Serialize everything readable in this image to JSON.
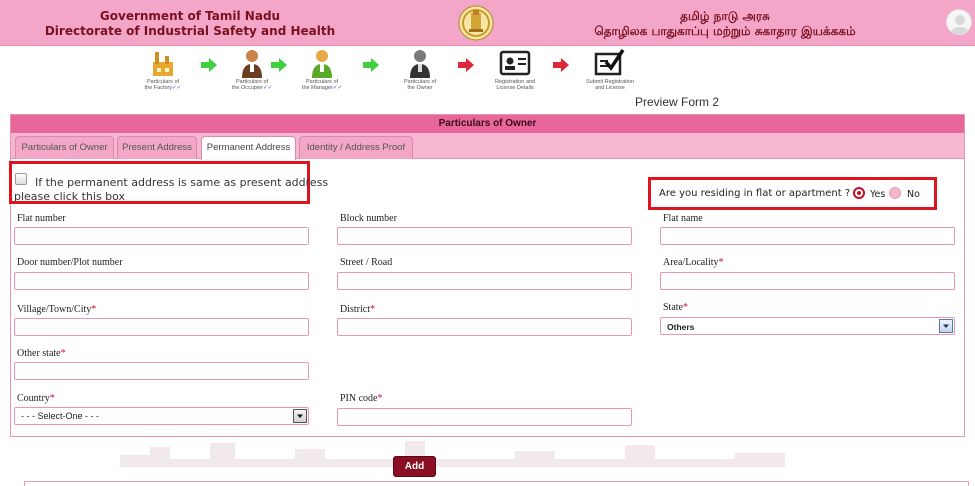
{
  "header": {
    "left_line1": "Government of Tamil Nadu",
    "left_line2": "Directorate of Industrial Safety and Health",
    "right_line1": "தமிழ் நாடு அரசு",
    "right_line2": "தொழிலக பாதுகாப்பு மற்றும் சுகாதார இயக்ககம்",
    "emblem_icon": "tamil-nadu-emblem",
    "avatar_icon": "user-avatar-icon"
  },
  "steps": [
    {
      "label1": "Particulars of",
      "label2": "the Factory",
      "done": "✓✓",
      "icon": "factory-icon"
    },
    {
      "label1": "Particulars of",
      "label2": "the Occupier",
      "done": "✓✓",
      "icon": "occupier-icon"
    },
    {
      "label1": "Particulars of",
      "label2": "the Manager",
      "done": "✓✓",
      "icon": "manager-icon"
    },
    {
      "label1": "Particulars of",
      "label2": "the Owner",
      "done": "",
      "icon": "owner-icon"
    },
    {
      "label1": "Registration and",
      "label2": "License Details",
      "done": "",
      "icon": "registration-card-icon"
    },
    {
      "label1": "Submit Registration",
      "label2": "and License",
      "done": "",
      "icon": "submit-check-icon"
    }
  ],
  "preview_label": "Preview Form 2",
  "panel": {
    "title": "Particulars of Owner",
    "tabs": [
      "Particulars of Owner",
      "Present Address",
      "Permanent Address",
      "Identity / Address Proof"
    ],
    "active_tab": "Permanent Address"
  },
  "same_address": {
    "line1": "If the permanent address is same as present address",
    "line2": "please click this box",
    "checked": false
  },
  "residence": {
    "question": "Are you residing in flat or apartment ?",
    "yes": "Yes",
    "no": "No",
    "selected": "Yes"
  },
  "fields": {
    "flat_number": {
      "label": "Flat number",
      "required": "",
      "value": ""
    },
    "block_number": {
      "label": "Block number",
      "required": "",
      "value": ""
    },
    "flat_name": {
      "label": "Flat name",
      "required": "",
      "value": ""
    },
    "door_number": {
      "label": "Door number/Plot number",
      "required": "",
      "value": ""
    },
    "street": {
      "label": "Street / Road",
      "required": "",
      "value": ""
    },
    "area": {
      "label": "Area/Locality",
      "required": "*",
      "value": ""
    },
    "village": {
      "label": "Village/Town/City",
      "required": "*",
      "value": ""
    },
    "district": {
      "label": "District",
      "required": "*",
      "value": ""
    },
    "state": {
      "label": "State",
      "required": "*",
      "value": "Others"
    },
    "other_state": {
      "label": "Other state",
      "required": "*",
      "value": ""
    },
    "country": {
      "label": "Country",
      "required": "*",
      "value": "- - - Select-One - - -"
    },
    "pin_code": {
      "label": "PIN code",
      "required": "*",
      "value": ""
    }
  },
  "add_button": "Add",
  "colors": {
    "header_bg": "#f3a6c8",
    "header_text": "#7a1020",
    "panel_title_bg": "#e8679a",
    "tabbar_bg": "#f6b6cf",
    "highlight_red": "#e0141e",
    "add_button_bg": "#8a0f22",
    "arrow_green": "#3fcf3f",
    "arrow_red": "#e0263a"
  }
}
